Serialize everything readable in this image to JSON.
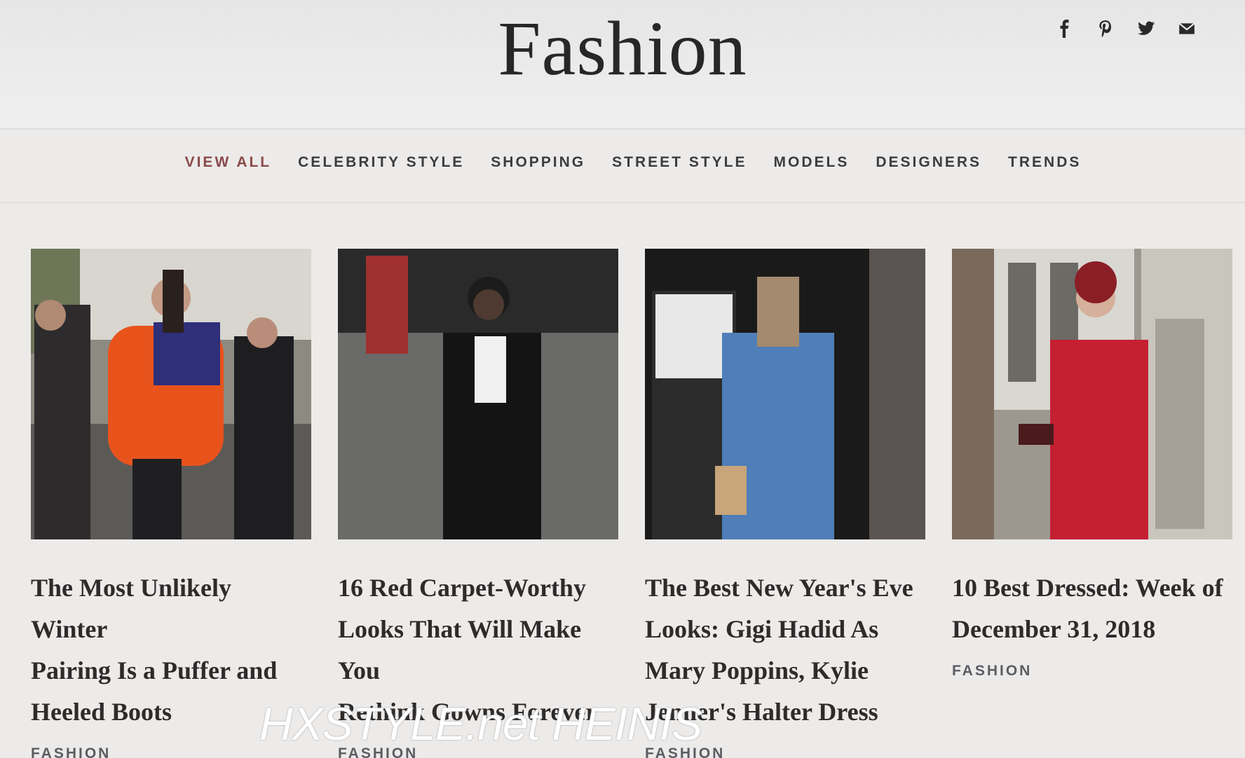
{
  "header": {
    "title": "Fashion",
    "social": [
      {
        "icon": "facebook-icon",
        "glyph": "f"
      },
      {
        "icon": "pinterest-icon",
        "glyph": "P"
      },
      {
        "icon": "twitter-icon",
        "glyph": "t"
      },
      {
        "icon": "email-icon",
        "glyph": "✉"
      }
    ]
  },
  "nav": {
    "items": [
      "VIEW ALL",
      "CELEBRITY STYLE",
      "SHOPPING",
      "STREET STYLE",
      "MODELS",
      "DESIGNERS",
      "TRENDS"
    ],
    "active_color": "#8b4a4a"
  },
  "articles": [
    {
      "title_lines": [
        "The Most Unlikely Winter",
        "Pairing Is a Puffer and",
        "Heeled Boots"
      ],
      "tag": "FASHION"
    },
    {
      "title_lines": [
        "16 Red Carpet-Worthy",
        "Looks That Will Make You",
        "Rethink Gowns Forever"
      ],
      "tag": "FASHION"
    },
    {
      "title_lines": [
        "The Best New Year's Eve",
        "Looks: Gigi Hadid As",
        "Mary Poppins, Kylie",
        "Jenner's Halter Dress"
      ],
      "tag": "FASHION"
    },
    {
      "title_lines": [
        "10 Best Dressed: Week of",
        "December 31, 2018"
      ],
      "tag": "FASHION"
    }
  ],
  "watermark": "HXSTYLE.net HEINIS"
}
